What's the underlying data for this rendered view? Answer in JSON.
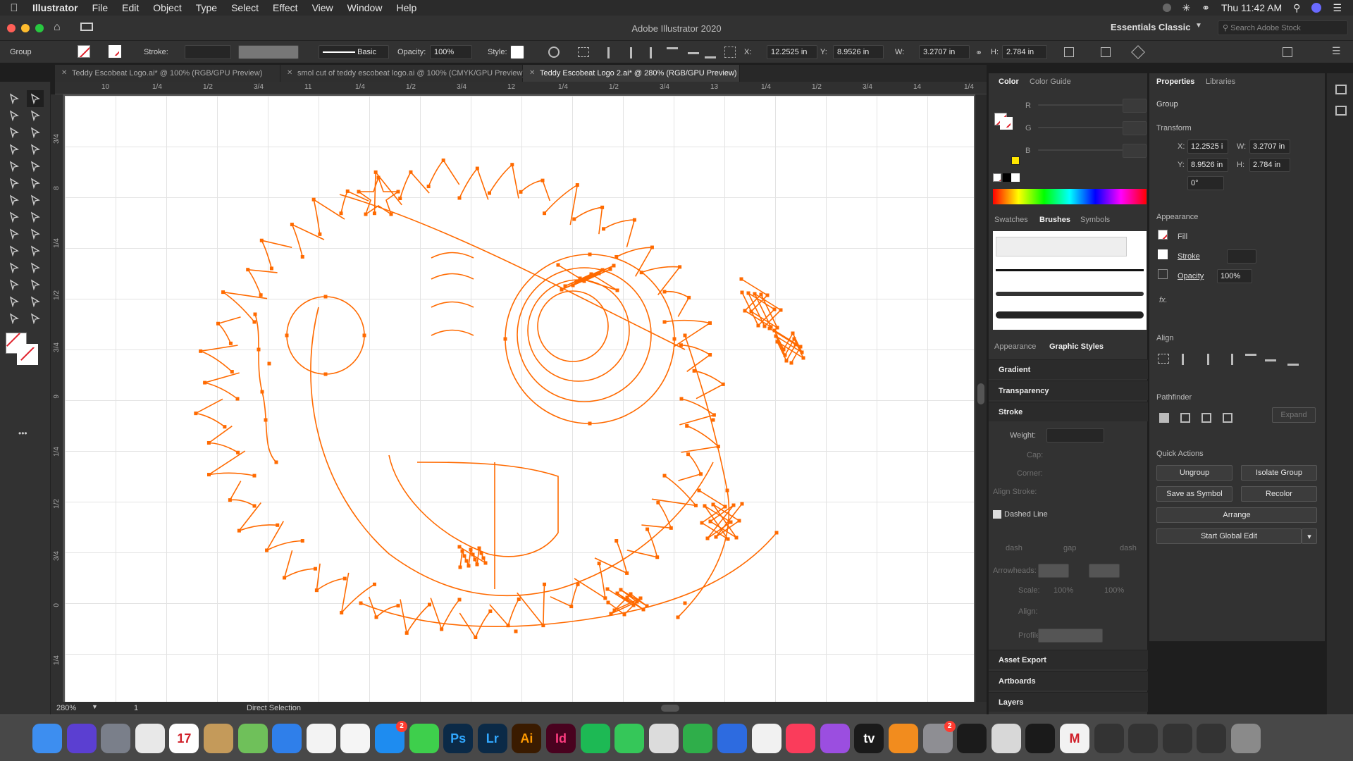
{
  "menubar": {
    "app_name": "Illustrator",
    "items": [
      "File",
      "Edit",
      "Object",
      "Type",
      "Select",
      "Effect",
      "View",
      "Window",
      "Help"
    ],
    "clock": "Thu 11:42 AM"
  },
  "window": {
    "title": "Adobe Illustrator 2020",
    "workspace": "Essentials Classic",
    "search_placeholder": "Search Adobe Stock"
  },
  "controlbar": {
    "selection_type": "Group",
    "stroke_label": "Stroke:",
    "brush_label": "Basic",
    "opacity_label": "Opacity:",
    "opacity_value": "100%",
    "style_label": "Style:",
    "x_label": "X:",
    "x_value": "12.2525 in",
    "y_label": "Y:",
    "y_value": "8.9526 in",
    "w_label": "W:",
    "w_value": "3.2707 in",
    "h_label": "H:",
    "h_value": "2.784 in"
  },
  "tabs": [
    {
      "label": "Teddy Escobeat Logo.ai* @ 100% (RGB/GPU Preview)",
      "active": false
    },
    {
      "label": "smol cut of teddy escobeat logo.ai @ 100% (CMYK/GPU Preview)",
      "active": false
    },
    {
      "label": "Teddy Escobeat Logo 2.ai* @ 280% (RGB/GPU Preview)",
      "active": true
    }
  ],
  "ruler": {
    "top_ticks": [
      "10",
      "1/4",
      "1/2",
      "3/4",
      "11",
      "1/4",
      "1/2",
      "3/4",
      "12",
      "1/4",
      "1/2",
      "3/4",
      "13",
      "1/4",
      "1/2",
      "3/4",
      "14",
      "1/4"
    ],
    "left_ticks": [
      "3/4",
      "8",
      "1/4",
      "1/2",
      "3/4",
      "9",
      "1/4",
      "1/2",
      "3/4",
      "0",
      "1/4"
    ]
  },
  "status": {
    "zoom": "280%",
    "artboard": "1",
    "tool": "Direct Selection"
  },
  "mid_panel": {
    "color_tabs": [
      "Color",
      "Color Guide"
    ],
    "rgb_labels": [
      "R",
      "G",
      "B"
    ],
    "library_tabs": [
      "Swatches",
      "Brushes",
      "Symbols"
    ],
    "style_tabs": [
      "Appearance",
      "Graphic Styles"
    ],
    "sections": [
      "Gradient",
      "Transparency",
      "Stroke"
    ],
    "stroke": {
      "weight": "Weight:",
      "cap": "Cap:",
      "corner": "Corner:",
      "align": "Align Stroke:",
      "dashed": "Dashed Line",
      "dash": "dash",
      "gap": "gap",
      "arrowheads": "Arrowheads:",
      "scale": "Scale:",
      "scale_val": "100%",
      "align2": "Align:",
      "profile": "Profile:"
    },
    "bottom": [
      "Asset Export",
      "Artboards",
      "Layers"
    ]
  },
  "properties": {
    "tabs": [
      "Properties",
      "Libraries"
    ],
    "selection": "Group",
    "transform": "Transform",
    "x_label": "X:",
    "x": "12.2525 i",
    "y_label": "Y:",
    "y": "8.9526 in",
    "w_label": "W:",
    "w": "3.2707 in",
    "h_label": "H:",
    "h": "2.784 in",
    "angle": "0°",
    "appearance": "Appearance",
    "fill": "Fill",
    "stroke": "Stroke",
    "opacity": "Opacity",
    "opacity_val": "100%",
    "fx": "fx.",
    "align": "Align",
    "pathfinder": "Pathfinder",
    "expand": "Expand",
    "quick_actions": "Quick Actions",
    "buttons": [
      "Ungroup",
      "Isolate Group",
      "Save as Symbol",
      "Recolor",
      "Arrange",
      "Start Global Edit"
    ]
  },
  "colors": {
    "artwork": "#ff6a00",
    "accent_blue": "#0a84ff"
  },
  "dock": {
    "apps": [
      {
        "name": "Finder",
        "label": "",
        "color": "#3d8ef0"
      },
      {
        "name": "Siri",
        "label": "",
        "color": "#5b3fd1"
      },
      {
        "name": "Launchpad",
        "label": "",
        "color": "#7a7f8a"
      },
      {
        "name": "Chrome",
        "label": "",
        "color": "#e8e8e8"
      },
      {
        "name": "Calendar",
        "label": "17",
        "color": "#ffffff"
      },
      {
        "name": "Contacts",
        "label": "",
        "color": "#c49a5a"
      },
      {
        "name": "Maps",
        "label": "",
        "color": "#6fc05a"
      },
      {
        "name": "Safari",
        "label": "",
        "color": "#2f7fea"
      },
      {
        "name": "Photos",
        "label": "",
        "color": "#f3f3f3"
      },
      {
        "name": "Reminders",
        "label": "",
        "color": "#f5f5f5"
      },
      {
        "name": "App Store",
        "label": "",
        "color": "#1e8cf0",
        "badge": "2"
      },
      {
        "name": "Messages",
        "label": "",
        "color": "#3ecf4c"
      },
      {
        "name": "Photoshop",
        "label": "Ps",
        "color": "#0b2a47"
      },
      {
        "name": "Lightroom",
        "label": "Lr",
        "color": "#0b2a47"
      },
      {
        "name": "Illustrator",
        "label": "Ai",
        "color": "#3a1b00"
      },
      {
        "name": "InDesign",
        "label": "Id",
        "color": "#49021f"
      },
      {
        "name": "Spotify",
        "label": "",
        "color": "#1db954"
      },
      {
        "name": "FaceTime",
        "label": "",
        "color": "#35c759"
      },
      {
        "name": "Preview",
        "label": "",
        "color": "#dcdcdc"
      },
      {
        "name": "Numbers",
        "label": "",
        "color": "#2fae4a"
      },
      {
        "name": "Keynote",
        "label": "",
        "color": "#2d6be0"
      },
      {
        "name": "News",
        "label": "",
        "color": "#f1f1f1"
      },
      {
        "name": "Music",
        "label": "",
        "color": "#fa3c5b"
      },
      {
        "name": "Podcasts",
        "label": "",
        "color": "#9b4ee0"
      },
      {
        "name": "TV",
        "label": "tv",
        "color": "#1a1a1a"
      },
      {
        "name": "Books",
        "label": "",
        "color": "#f28c1e"
      },
      {
        "name": "System Preferences",
        "label": "",
        "color": "#8e8e93",
        "badge": "2"
      },
      {
        "name": "Activity Monitor",
        "label": "",
        "color": "#1b1b1b"
      },
      {
        "name": "Script Editor",
        "label": "",
        "color": "#d8d8d8"
      },
      {
        "name": "Acrobat",
        "label": "",
        "color": "#1a1a1a"
      },
      {
        "name": "Gmail",
        "label": "M",
        "color": "#f2f2f2"
      },
      {
        "name": "Window 1",
        "label": "",
        "color": "#333"
      },
      {
        "name": "Window 2",
        "label": "",
        "color": "#333"
      },
      {
        "name": "Window 3",
        "label": "",
        "color": "#333"
      },
      {
        "name": "Window 4",
        "label": "",
        "color": "#333"
      },
      {
        "name": "Trash",
        "label": "",
        "color": "#8a8a8a"
      }
    ]
  }
}
